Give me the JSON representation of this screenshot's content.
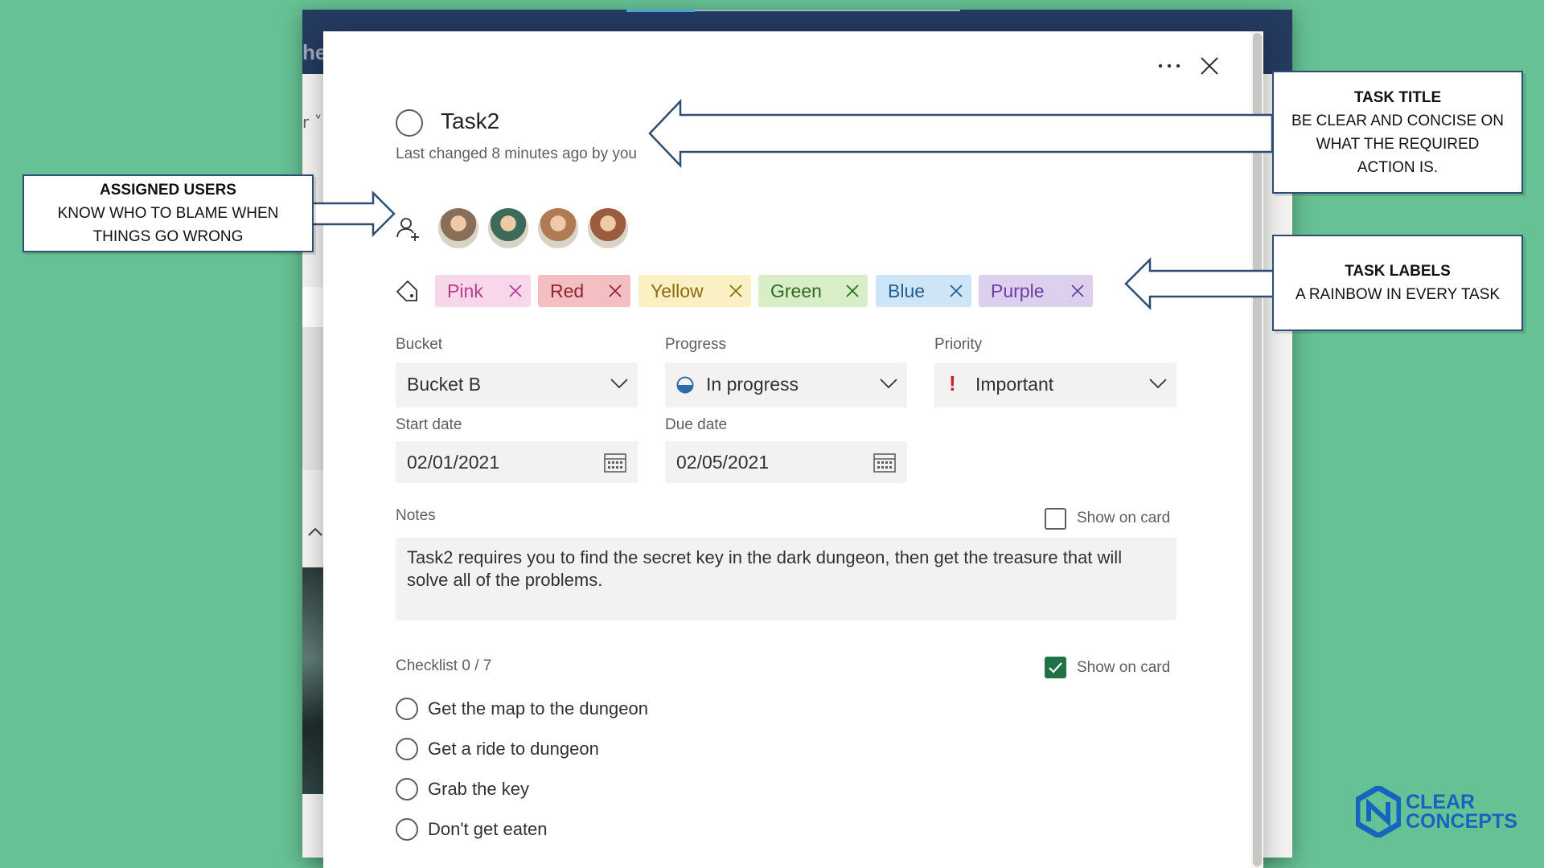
{
  "background_app": {
    "heading_fragment": "her",
    "chevron_fragment": "r ˅"
  },
  "task": {
    "title": "Task2",
    "last_changed": "Last changed 8 minutes ago by you"
  },
  "assigned_users": [
    {
      "name": "user-1",
      "color": "#8a6f58"
    },
    {
      "name": "user-2",
      "color": "#3d6b5a"
    },
    {
      "name": "user-3",
      "color": "#b07a55"
    },
    {
      "name": "user-4",
      "color": "#9b5b3e"
    }
  ],
  "labels": [
    {
      "text": "Pink",
      "bg": "#f9d7ea",
      "fg": "#b63b8a"
    },
    {
      "text": "Red",
      "bg": "#f3bfc3",
      "fg": "#8f2431"
    },
    {
      "text": "Yellow",
      "bg": "#fbf0c4",
      "fg": "#8a6b0a"
    },
    {
      "text": "Green",
      "bg": "#d7eec9",
      "fg": "#2e6a1e"
    },
    {
      "text": "Blue",
      "bg": "#cde5f7",
      "fg": "#1f5f95"
    },
    {
      "text": "Purple",
      "bg": "#ddd0ef",
      "fg": "#6a3ea1"
    }
  ],
  "fields": {
    "bucket": {
      "label": "Bucket",
      "value": "Bucket B"
    },
    "progress": {
      "label": "Progress",
      "value": "In progress"
    },
    "priority": {
      "label": "Priority",
      "value": "Important",
      "marker": "!"
    },
    "start_date": {
      "label": "Start date",
      "value": "02/01/2021"
    },
    "due_date": {
      "label": "Due date",
      "value": "02/05/2021"
    }
  },
  "notes": {
    "label": "Notes",
    "show_on_card_label": "Show on card",
    "show_on_card_checked": false,
    "text": "Task2 requires you to find the secret key in the dark dungeon, then get the treasure that will solve all of the problems."
  },
  "checklist": {
    "label": "Checklist 0 / 7",
    "show_on_card_label": "Show on card",
    "show_on_card_checked": true,
    "items": [
      {
        "text": "Get the map to the dungeon"
      },
      {
        "text": "Get a ride to dungeon"
      },
      {
        "text": "Grab the key"
      },
      {
        "text": "Don't get eaten"
      }
    ]
  },
  "callouts": {
    "task_title": {
      "title": "TASK TITLE",
      "lines": [
        "BE CLEAR AND CONCISE ON",
        "WHAT THE REQUIRED",
        "ACTION IS."
      ]
    },
    "assigned_users": {
      "title": "ASSIGNED USERS",
      "lines": [
        "KNOW WHO TO BLAME WHEN",
        "THINGS GO WRONG"
      ]
    },
    "task_labels": {
      "title": "TASK LABELS",
      "lines": [
        "A RAINBOW IN EVERY TASK"
      ]
    }
  },
  "logo": {
    "line1": "CLEAR",
    "line2": "CONCEPTS",
    "color": "#1565c0"
  },
  "colors": {
    "accent": "#217346",
    "progress_blue": "#2b6cb0",
    "priority_red": "#c4262e",
    "arrow_stroke": "#2f4d73"
  }
}
